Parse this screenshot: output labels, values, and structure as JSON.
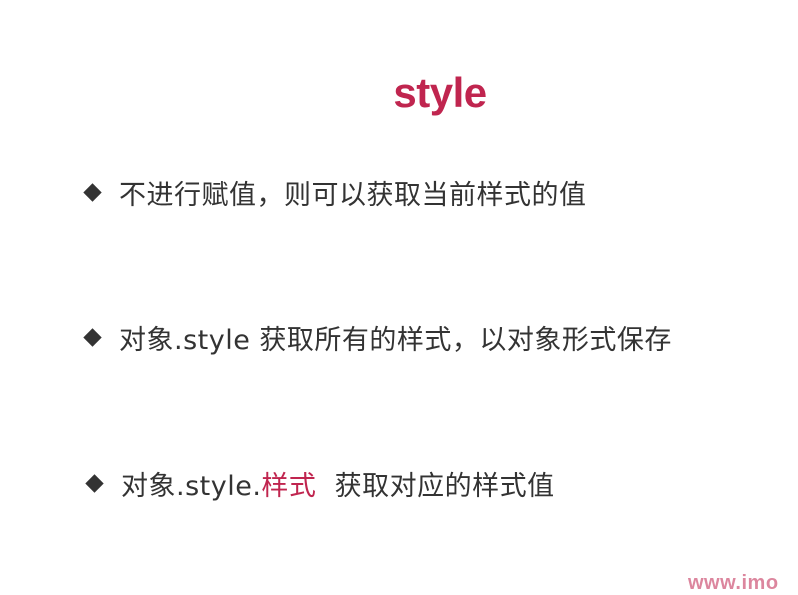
{
  "slide": {
    "title": "style",
    "bullets": [
      {
        "text": "不进行赋值，则可以获取当前样式的值"
      },
      {
        "text": "对象.style 获取所有的样式，以对象形式保存"
      },
      {
        "prefix": "对象.style.",
        "highlight": "样式",
        "suffix": "  获取对应的样式值"
      }
    ]
  },
  "watermark": {
    "text": "www.imo"
  },
  "colors": {
    "accent": "#c0254f",
    "body_text": "#333333",
    "watermark": "#c0254f",
    "background": "#ffffff"
  },
  "icons": {
    "bullet": "diamond-bullet-icon"
  }
}
